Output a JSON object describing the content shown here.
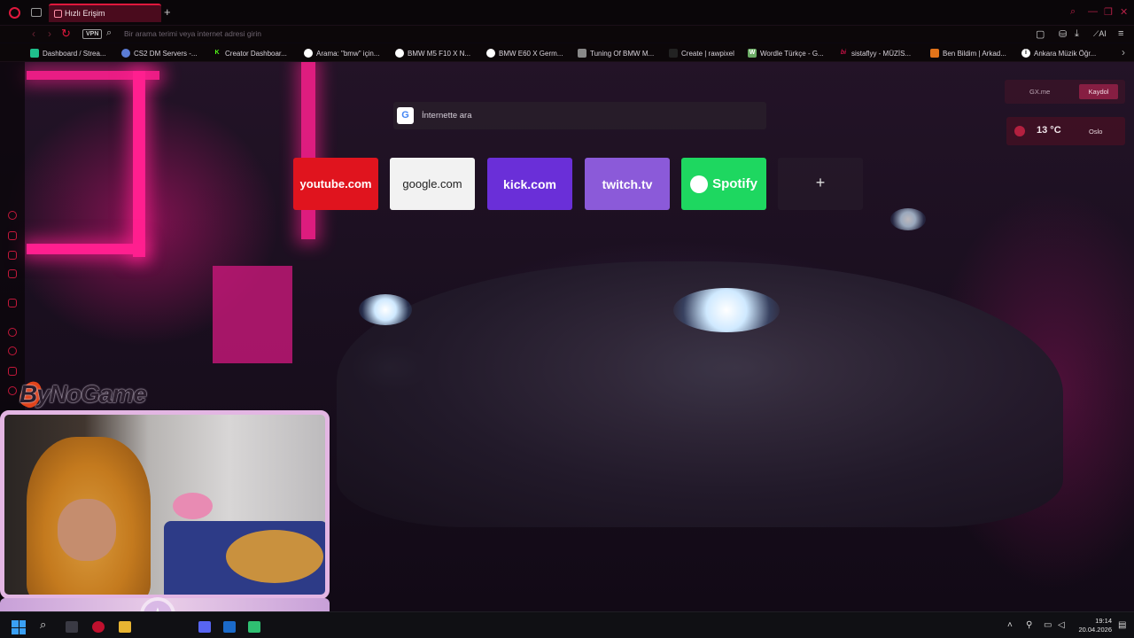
{
  "browser": {
    "tab_title": "Hızlı Erişim",
    "new_tab_symbol": "+",
    "vpn_label": "VPN",
    "address_placeholder": "Bir arama terimi veya internet adresi girin",
    "ai_label": "AI"
  },
  "bookmarks": [
    {
      "label": "Dashboard / Strea...",
      "color": "#1fbf8c",
      "glyph": ""
    },
    {
      "label": "CS2 DM Servers -...",
      "color": "#5b7cd6",
      "glyph": ""
    },
    {
      "label": "Creator Dashboar...",
      "color": "#53fc18",
      "glyph": "K"
    },
    {
      "label": "Arama: \"bmw\" için...",
      "color": "#ffffff",
      "glyph": ""
    },
    {
      "label": "BMW M5 F10 X N...",
      "color": "#ffffff",
      "glyph": ""
    },
    {
      "label": "BMW E60 X Germ...",
      "color": "#ffffff",
      "glyph": ""
    },
    {
      "label": "Tuning Of BMW M...",
      "color": "#888888",
      "glyph": ""
    },
    {
      "label": "Create | rawpixel",
      "color": "#222222",
      "glyph": ""
    },
    {
      "label": "Wordle Türkçe - G...",
      "color": "#6aaa64",
      "glyph": "W"
    },
    {
      "label": "sistaflyy - MÜZİS...",
      "color": "#d11149",
      "glyph": "bi"
    },
    {
      "label": "Ben Bildim | Arkad...",
      "color": "#e2731a",
      "glyph": ""
    },
    {
      "label": "Ankara Müzik Öğr...",
      "color": "#ffffff",
      "glyph": "i"
    }
  ],
  "search": {
    "engine_logo": "G",
    "placeholder": "İnternette ara"
  },
  "speed_dial": [
    {
      "label": "youtube.com",
      "color": "#e0141e"
    },
    {
      "label": "google.com",
      "color": "#f2f2f2"
    },
    {
      "label": "kick.com",
      "color": "#6a2fd8"
    },
    {
      "label": "twitch.tv",
      "color": "#8b5ad9"
    },
    {
      "label": "Spotify",
      "color": "#1ed760"
    }
  ],
  "speed_dial_add": "+",
  "gx_panel": {
    "site": "GX.me",
    "register": "Kaydol"
  },
  "weather": {
    "temp": "13 °C",
    "city": "Oslo"
  },
  "stream_overlay": {
    "brand": "ByNoGame"
  },
  "taskbar": {
    "time": "19:14",
    "date": "20.04.2026"
  }
}
